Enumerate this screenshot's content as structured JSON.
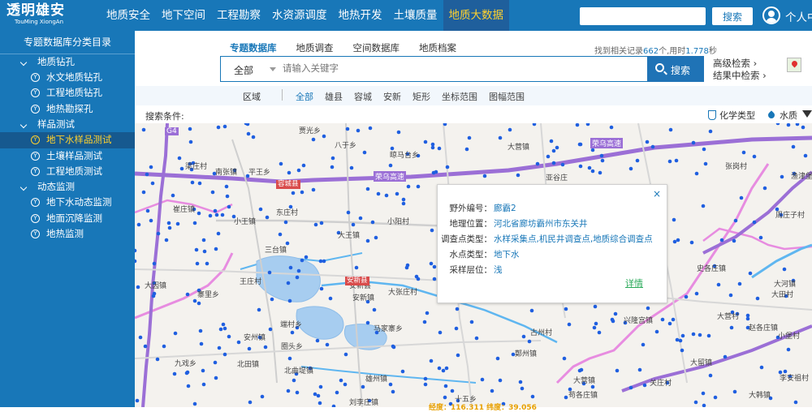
{
  "logo": {
    "name": "透明雄安",
    "sub": "TouMing XiongAn"
  },
  "nav": {
    "items": [
      "地质安全",
      "地下空间",
      "工程勘察",
      "水资源调度",
      "地热开发",
      "土壤质量",
      "地质大数据"
    ],
    "active_index": 6
  },
  "header": {
    "search_button": "搜索",
    "user_label": "个人中"
  },
  "sidebar": {
    "title": "专题数据库分类目录",
    "groups": [
      {
        "label": "地质钻孔",
        "items": [
          {
            "label": "水文地质钻孔"
          },
          {
            "label": "工程地质钻孔"
          },
          {
            "label": "地热勘探孔"
          }
        ]
      },
      {
        "label": "样品测试",
        "items": [
          {
            "label": "地下水样品测试",
            "active": true
          },
          {
            "label": "土壤样品测试"
          },
          {
            "label": "工程地质测试"
          }
        ]
      },
      {
        "label": "动态监测",
        "items": [
          {
            "label": "地下水动态监测"
          },
          {
            "label": "地面沉降监测"
          },
          {
            "label": "地热监测"
          }
        ]
      }
    ]
  },
  "tabs": {
    "items": [
      "专题数据库",
      "地质调查",
      "空间数据库",
      "地质档案"
    ],
    "active_index": 0
  },
  "found": {
    "prefix": "找到相关记录",
    "count": "662",
    "mid": "个,用时",
    "time": "1.778",
    "suffix": "秒"
  },
  "search": {
    "scope": "全部",
    "placeholder": "请输入关键字",
    "button": "搜索"
  },
  "links": {
    "advanced": "高级检索 ›",
    "within_results": "结果中检索 ›"
  },
  "filter": {
    "label": "区域",
    "options": [
      "全部",
      "雄县",
      "容城",
      "安新",
      "矩形",
      "坐标范围",
      "图幅范围"
    ],
    "active_index": 0
  },
  "conditions": {
    "label": "搜索条件:"
  },
  "tools": {
    "chemistry": "化学类型",
    "water": "水质"
  },
  "colors": {
    "primary": "#1877b8",
    "active_text": "#ffd12e",
    "point": "#1f5fe0",
    "highway": "#9b6fd6",
    "pink": "#e78ce0",
    "water": "#5fb6f0"
  },
  "map": {
    "regions": [
      "容城县",
      "安新县"
    ],
    "highways": [
      "G4",
      "荣乌高速",
      "荣乌高速"
    ],
    "labels": [
      "贾光乡",
      "八于乡",
      "晾马台乡",
      "大营镇",
      "梁庄村",
      "南张镇",
      "平王乡",
      "亚谷庄",
      "张岗村",
      "渔津堡",
      "崔庄镇",
      "东庄村",
      "小王镇",
      "小阳村",
      "周庄子村",
      "大王镇",
      "三台镇",
      "史各庄镇",
      "大因镇",
      "王庄村",
      "大河镇",
      "寨里乡",
      "安新镇",
      "大张庄村",
      "大田村",
      "端村乡",
      "马家寨乡",
      "兴隆宫镇",
      "赵各庄镇",
      "小堡村",
      "安州镇",
      "圈头乡",
      "北田镇",
      "大留镇",
      "古州村",
      "鄚州镇",
      "九戏乡",
      "大营镇",
      "北曲堤镇",
      "雄州镇",
      "刘李庄镇",
      "大韩镇",
      "关庄村",
      "李安祖村",
      "十五乡",
      "苟各庄镇",
      "大营村",
      "安新县"
    ]
  },
  "popup": {
    "rows": [
      {
        "label": "野外编号：",
        "value": "廊霸2"
      },
      {
        "label": "地理位置：",
        "value": "河北省廊坊霸州市东关井"
      },
      {
        "label": "调查点类型：",
        "value": "水样采集点,机民井调查点,地质综合调查点"
      },
      {
        "label": "水点类型：",
        "value": "地下水"
      },
      {
        "label": "采样层位：",
        "value": "浅"
      }
    ],
    "detail": "详情",
    "close": "×"
  },
  "scale": {
    "text": "经度：116.311 纬度：39.056"
  }
}
